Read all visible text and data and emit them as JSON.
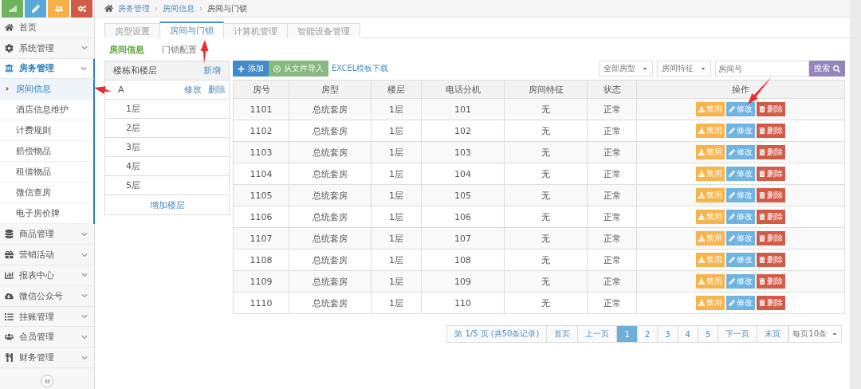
{
  "sidebar": {
    "menu": [
      {
        "label": "首页",
        "expanded": false,
        "has_children": false
      },
      {
        "label": "系统管理",
        "expanded": false,
        "has_children": true
      },
      {
        "label": "房务管理",
        "expanded": true,
        "has_children": true,
        "children": [
          {
            "label": "房间信息",
            "selected": true
          },
          {
            "label": "酒店信息维护",
            "selected": false
          },
          {
            "label": "计费规则",
            "selected": false
          },
          {
            "label": "赔偿物品",
            "selected": false
          },
          {
            "label": "租借物品",
            "selected": false
          },
          {
            "label": "微信查房",
            "selected": false
          },
          {
            "label": "电子房价牌",
            "selected": false
          }
        ]
      },
      {
        "label": "商品管理",
        "expanded": false,
        "has_children": true
      },
      {
        "label": "营销活动",
        "expanded": false,
        "has_children": true
      },
      {
        "label": "报表中心",
        "expanded": false,
        "has_children": true
      },
      {
        "label": "微信公众号",
        "expanded": false,
        "has_children": true
      },
      {
        "label": "挂账管理",
        "expanded": false,
        "has_children": true
      },
      {
        "label": "会员管理",
        "expanded": false,
        "has_children": true
      },
      {
        "label": "财务管理",
        "expanded": false,
        "has_children": true
      }
    ]
  },
  "breadcrumb": [
    "房务管理",
    "房间信息",
    "房间与门锁"
  ],
  "breadcrumb_separator": "›",
  "tabs": [
    {
      "label": "房型设置",
      "selected": false
    },
    {
      "label": "房间与门锁",
      "selected": true
    },
    {
      "label": "计算机管理",
      "selected": false
    },
    {
      "label": "智能设备管理",
      "selected": false
    }
  ],
  "subtabs": [
    {
      "label": "房间信息",
      "selected": true
    },
    {
      "label": "门锁配置",
      "selected": false
    }
  ],
  "building_panel": {
    "title": "楼栋和楼层",
    "add": "新增",
    "building": {
      "name": "A",
      "actions": [
        "修改",
        "删除"
      ]
    },
    "floors": [
      "1层",
      "2层",
      "3层",
      "4层",
      "5层"
    ],
    "add_floor": "增加楼层"
  },
  "toolbar": {
    "add": "添加",
    "import": "从文件导入",
    "template_link": "EXCEL模板下载",
    "room_type": "全部房型",
    "feature": "房间特征",
    "search_placeholder": "房间号",
    "search": "搜索"
  },
  "table": {
    "columns": [
      "房号",
      "房型",
      "楼层",
      "电话分机",
      "房间特征",
      "状态",
      "操作"
    ],
    "rows": [
      {
        "cells": [
          "1101",
          "总统套房",
          "1层",
          "101",
          "无",
          "正常"
        ],
        "actions": [
          {
            "kind": "disable",
            "label": "禁用"
          },
          {
            "kind": "edit",
            "label": "修改"
          },
          {
            "kind": "delete",
            "label": "删除"
          }
        ]
      },
      {
        "cells": [
          "1102",
          "总统套房",
          "1层",
          "102",
          "无",
          "正常"
        ],
        "actions": [
          {
            "kind": "disable",
            "label": "禁用"
          },
          {
            "kind": "edit",
            "label": "修改"
          },
          {
            "kind": "delete",
            "label": "删除"
          }
        ]
      },
      {
        "cells": [
          "1103",
          "总统套房",
          "1层",
          "103",
          "无",
          "正常"
        ],
        "actions": [
          {
            "kind": "disable",
            "label": "禁用"
          },
          {
            "kind": "edit",
            "label": "修改"
          },
          {
            "kind": "delete",
            "label": "删除"
          }
        ]
      },
      {
        "cells": [
          "1104",
          "总统套房",
          "1层",
          "104",
          "无",
          "正常"
        ],
        "actions": [
          {
            "kind": "disable",
            "label": "禁用"
          },
          {
            "kind": "edit",
            "label": "修改"
          },
          {
            "kind": "delete",
            "label": "删除"
          }
        ]
      },
      {
        "cells": [
          "1105",
          "总统套房",
          "1层",
          "105",
          "无",
          "正常"
        ],
        "actions": [
          {
            "kind": "disable",
            "label": "禁用"
          },
          {
            "kind": "edit",
            "label": "修改"
          },
          {
            "kind": "delete",
            "label": "删除"
          }
        ]
      },
      {
        "cells": [
          "1106",
          "总统套房",
          "1层",
          "106",
          "无",
          "正常"
        ],
        "actions": [
          {
            "kind": "disable",
            "label": "禁用"
          },
          {
            "kind": "edit",
            "label": "修改"
          },
          {
            "kind": "delete",
            "label": "删除"
          }
        ]
      },
      {
        "cells": [
          "1107",
          "总统套房",
          "1层",
          "107",
          "无",
          "正常"
        ],
        "actions": [
          {
            "kind": "disable",
            "label": "禁用"
          },
          {
            "kind": "edit",
            "label": "修改"
          },
          {
            "kind": "delete",
            "label": "删除"
          }
        ]
      },
      {
        "cells": [
          "1108",
          "总统套房",
          "1层",
          "108",
          "无",
          "正常"
        ],
        "actions": [
          {
            "kind": "disable",
            "label": "禁用"
          },
          {
            "kind": "edit",
            "label": "修改"
          },
          {
            "kind": "delete",
            "label": "删除"
          }
        ]
      },
      {
        "cells": [
          "1109",
          "总统套房",
          "1层",
          "109",
          "无",
          "正常"
        ],
        "actions": [
          {
            "kind": "disable",
            "label": "禁用"
          },
          {
            "kind": "edit",
            "label": "修改"
          },
          {
            "kind": "delete",
            "label": "删除"
          }
        ]
      },
      {
        "cells": [
          "1110",
          "总统套房",
          "1层",
          "110",
          "无",
          "正常"
        ],
        "actions": [
          {
            "kind": "disable",
            "label": "禁用"
          },
          {
            "kind": "edit",
            "label": "修改"
          },
          {
            "kind": "delete",
            "label": "删除"
          }
        ]
      }
    ]
  },
  "pagination": {
    "summary": "第 1/5 页 (共50条记录)",
    "first": "首页",
    "prev": "上一页",
    "pages": [
      {
        "label": "1",
        "selected": true
      },
      {
        "label": "2",
        "selected": false
      },
      {
        "label": "3",
        "selected": false
      },
      {
        "label": "4",
        "selected": false
      },
      {
        "label": "5",
        "selected": false
      }
    ],
    "next": "下一页",
    "last": "末页",
    "page_size": "每页10条"
  }
}
